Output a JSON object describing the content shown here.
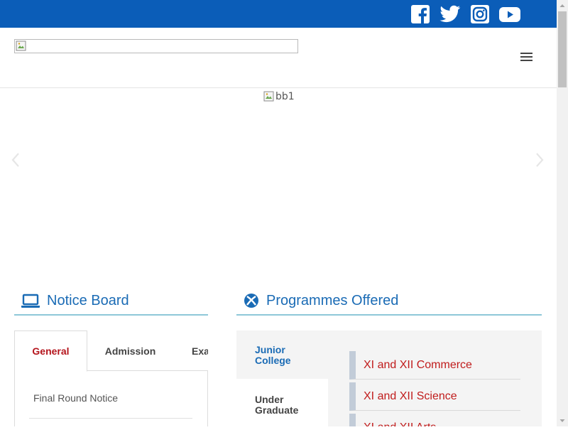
{
  "social": {
    "icons": [
      "facebook-icon",
      "twitter-icon",
      "instagram-icon",
      "youtube-icon"
    ]
  },
  "header": {
    "menu_icon": "hamburger-menu-icon"
  },
  "slider": {
    "image_alt": "bb1"
  },
  "notice_board": {
    "title": "Notice Board",
    "tabs": [
      "General",
      "Admission",
      "Exa"
    ],
    "items": [
      "Final Round Notice"
    ]
  },
  "programmes": {
    "title": "Programmes Offered",
    "tabs": [
      "Junior College",
      "Under Graduate"
    ],
    "courses": [
      "XI and XII Commerce",
      "XI and XII Science",
      "XI and XII Arts"
    ]
  },
  "colors": {
    "topbar": "#0b5db8",
    "heading": "#1a6bb5",
    "accent_red": "#b4141c",
    "underline": "#8ec7d8"
  }
}
